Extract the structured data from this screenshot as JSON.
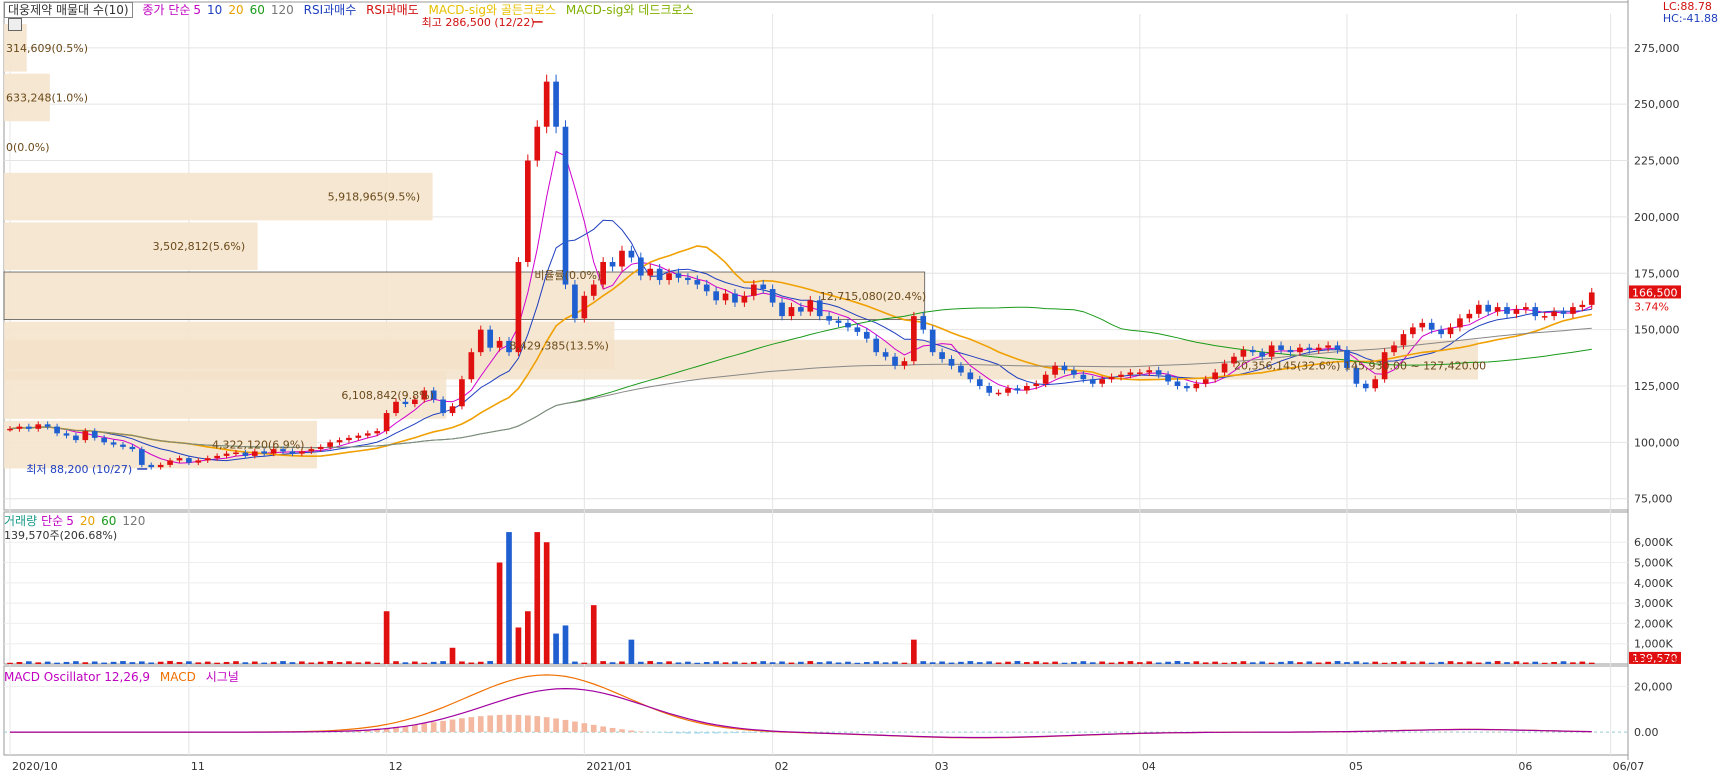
{
  "legend": {
    "price": [
      {
        "text": "대웅제약 매물대 수(10)",
        "color": "#333333",
        "boxed": true
      },
      {
        "text": "종가 단순",
        "color": "#c000c0"
      },
      {
        "text": "5",
        "color": "#c000c0"
      },
      {
        "text": "10",
        "color": "#1f3fbf"
      },
      {
        "text": "20",
        "color": "#e8a000"
      },
      {
        "text": "60",
        "color": "#1a9a1a"
      },
      {
        "text": "120",
        "color": "#777777"
      },
      {
        "text": "RSI과매수",
        "color": "#1f3fbf"
      },
      {
        "text": "RSI과매도",
        "color": "#d01010"
      },
      {
        "text": "MACD-sig와 골든크로스",
        "color": "#e8c000"
      },
      {
        "text": "MACD-sig와 데드크로스",
        "color": "#80b000"
      }
    ],
    "volume": [
      {
        "text": "거래량",
        "color": "#1a9a8a"
      },
      {
        "text": "단순",
        "color": "#c000c0"
      },
      {
        "text": "5",
        "color": "#c000c0"
      },
      {
        "text": "20",
        "color": "#e8a000"
      },
      {
        "text": "60",
        "color": "#1a9a1a"
      },
      {
        "text": "120",
        "color": "#777777"
      }
    ],
    "volume_value": "139,570주(206.68%)",
    "macd": [
      {
        "text": "MACD Oscillator 12,26,9",
        "color": "#c000c0"
      },
      {
        "text": "MACD",
        "color": "#f07000"
      },
      {
        "text": "시그널",
        "color": "#c000c0"
      }
    ]
  },
  "corner": {
    "lc": "LC:88.78",
    "hc": "HC:-41.88"
  },
  "chart_data": [
    {
      "type": "candlestick",
      "panel": "price",
      "ylim": [
        70000,
        290000
      ],
      "yticks": [
        75000,
        100000,
        125000,
        150000,
        175000,
        200000,
        225000,
        250000,
        275000
      ],
      "ytick_labels": [
        "75,000",
        "100,000",
        "125,000",
        "150,000",
        "175,000",
        "200,000",
        "225,000",
        "250,000",
        "275,000"
      ],
      "x_labels": [
        {
          "label": "2020/10",
          "index": 0
        },
        {
          "label": "11",
          "index": 19
        },
        {
          "label": "12",
          "index": 40
        },
        {
          "label": "2021/01",
          "index": 61
        },
        {
          "label": "02",
          "index": 81
        },
        {
          "label": "03",
          "index": 98
        },
        {
          "label": "04",
          "index": 120
        },
        {
          "label": "05",
          "index": 142
        },
        {
          "label": "06",
          "index": 160
        },
        {
          "label": "06/07",
          "index": 170
        }
      ],
      "n_slots": 172,
      "closes": [
        106000,
        107000,
        106000,
        108000,
        107000,
        104000,
        103000,
        101000,
        105000,
        102000,
        100000,
        99000,
        98000,
        97000,
        90000,
        89000,
        90000,
        92000,
        93000,
        91000,
        92000,
        93000,
        94000,
        95000,
        95500,
        94000,
        96000,
        95000,
        97000,
        96000,
        95000,
        96000,
        97000,
        98000,
        100000,
        101000,
        102000,
        103000,
        104000,
        105000,
        113000,
        118000,
        117000,
        119000,
        123000,
        119000,
        113000,
        116000,
        128000,
        140000,
        150000,
        142000,
        145000,
        140000,
        180000,
        225000,
        240000,
        260000,
        240000,
        170000,
        155000,
        165000,
        170000,
        180000,
        178000,
        185000,
        182000,
        174000,
        177000,
        172000,
        175000,
        173000,
        172000,
        170000,
        167000,
        163000,
        166000,
        162000,
        165000,
        170000,
        168000,
        162000,
        156000,
        160000,
        158000,
        163000,
        156000,
        154000,
        153000,
        151000,
        149000,
        146000,
        140000,
        138000,
        134000,
        136000,
        156000,
        150000,
        140000,
        137000,
        134000,
        131000,
        128000,
        125000,
        122000,
        122000,
        124000,
        123000,
        125000,
        126000,
        130000,
        134000,
        132000,
        130000,
        128000,
        126000,
        128000,
        129000,
        130000,
        131000,
        131000,
        132000,
        130000,
        127000,
        125000,
        124000,
        126000,
        128000,
        131000,
        135000,
        138000,
        141000,
        140000,
        138000,
        143000,
        141000,
        140000,
        142000,
        141000,
        142000,
        143000,
        141000,
        133000,
        126000,
        124000,
        128000,
        140000,
        143000,
        148000,
        151000,
        153000,
        150000,
        148000,
        151000,
        155000,
        157000,
        161000,
        158000,
        160000,
        157000,
        159000,
        160000,
        156000,
        156000,
        158000,
        157000,
        160000,
        161000,
        166500
      ],
      "annotations": [
        {
          "text": "최고 286,500 (12/22)",
          "color": "#d01010",
          "index": 57,
          "value": 286500
        },
        {
          "text": "최저 88,200 (10/27)",
          "color": "#1f3fbf",
          "index": 15,
          "value": 88200
        }
      ],
      "last_price": {
        "text": "166,500",
        "pct": "3.74%"
      }
    },
    {
      "type": "horizontal_bar",
      "panel": "price",
      "name": "매물대",
      "bins": [
        {
          "low": 264000,
          "high": 286000,
          "value": 314609,
          "label": "314,609(0.5%)",
          "pct": 0.5
        },
        {
          "low": 242000,
          "high": 264000,
          "value": 633248,
          "label": "633,248(1.0%)",
          "pct": 1.0
        },
        {
          "low": 220000,
          "high": 242000,
          "value": 0,
          "label": "0(0.0%)",
          "pct": 0.0
        },
        {
          "low": 198000,
          "high": 220000,
          "value": 5918965,
          "label": "5,918,965(9.5%)",
          "pct": 9.5
        },
        {
          "low": 176000,
          "high": 198000,
          "value": 3502812,
          "label": "3,502,812(5.6%)",
          "pct": 5.6
        },
        {
          "low": 154000,
          "high": 176000,
          "value": 12715080,
          "label": "12,715,080(20.4%)",
          "pct": 20.4
        },
        {
          "low": 132000,
          "high": 154000,
          "value": 8429385,
          "label": "8,429,385(13.5%)",
          "pct": 13.5
        },
        {
          "low": 110000,
          "high": 132000,
          "value": 6108842,
          "label": "6,108,842(9.8%)",
          "pct": 9.8
        },
        {
          "low": 88000,
          "high": 110000,
          "value": 4322120,
          "label": "4,322,120(6.9%)",
          "pct": 6.9
        },
        {
          "low": 127420,
          "high": 145930,
          "value": 20356145,
          "label": "20,356,145(32.6%)",
          "pct": 32.6,
          "range_label": "145,930.00 ~ 127,420.00",
          "max": true
        }
      ],
      "current_bin_label": "비율률(0.0%)"
    },
    {
      "type": "bar",
      "panel": "volume",
      "ylim": [
        0,
        6800
      ],
      "unit": "K",
      "yticks": [
        1000,
        2000,
        3000,
        4000,
        5000,
        6000
      ],
      "ytick_labels": [
        "1,000K",
        "2,000K",
        "3,000K",
        "4,000K",
        "5,000K",
        "6,000K"
      ],
      "last_value": {
        "text": "139,570",
        "pct": "206.68%"
      },
      "spikes": [
        {
          "index": 40,
          "value": 2600
        },
        {
          "index": 47,
          "value": 800
        },
        {
          "index": 52,
          "value": 5000
        },
        {
          "index": 53,
          "value": 6500
        },
        {
          "index": 54,
          "value": 1800
        },
        {
          "index": 55,
          "value": 2600
        },
        {
          "index": 56,
          "value": 6500
        },
        {
          "index": 57,
          "value": 6000
        },
        {
          "index": 58,
          "value": 1500
        },
        {
          "index": 59,
          "value": 1900
        },
        {
          "index": 62,
          "value": 2900
        },
        {
          "index": 66,
          "value": 1200
        },
        {
          "index": 96,
          "value": 1200
        }
      ]
    },
    {
      "type": "line",
      "panel": "macd",
      "ylim": [
        -10000,
        28000
      ],
      "yticks": [
        0,
        20000
      ],
      "ytick_labels": [
        "0.00",
        "20,000"
      ],
      "series": [
        {
          "name": "MACD",
          "peak_index": 57,
          "peak_value": 25000
        },
        {
          "name": "시그널",
          "peak_index": 59,
          "peak_value": 20000
        }
      ]
    }
  ]
}
